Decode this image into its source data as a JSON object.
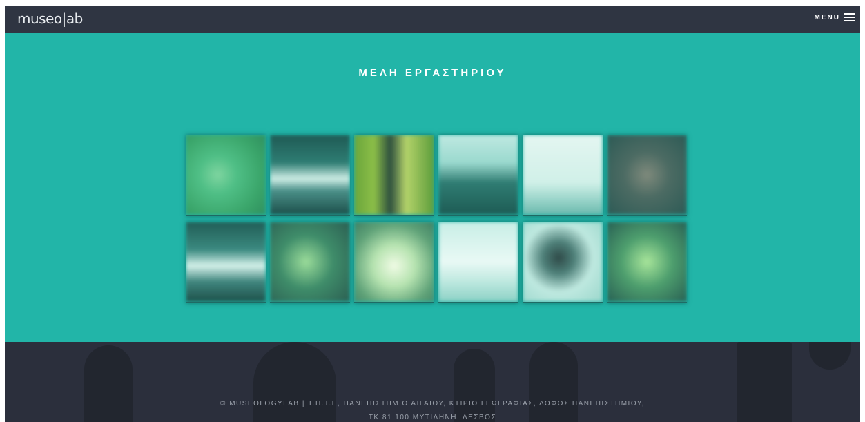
{
  "header": {
    "logo": "museo|ab",
    "menu_label": "MENU"
  },
  "main": {
    "title": "ΜΕΛΗ ΕΡΓΑΣΤΗΡΙΟΥ",
    "members": [
      {
        "icon": "member-photo"
      },
      {
        "icon": "member-photo"
      },
      {
        "icon": "member-photo"
      },
      {
        "icon": "member-photo"
      },
      {
        "icon": "member-photo"
      },
      {
        "icon": "member-photo"
      },
      {
        "icon": "member-photo"
      },
      {
        "icon": "member-photo"
      },
      {
        "icon": "member-photo"
      },
      {
        "icon": "member-photo"
      },
      {
        "icon": "member-photo"
      },
      {
        "icon": "member-photo"
      }
    ]
  },
  "footer": {
    "line1": "© MUSEOLOGYLAB  |  Τ.Π.Τ.Ε, ΠΑΝΕΠΙΣΤΗΜΙΟ ΑΙΓΑΙΟΥ, ΚΤΙΡΙΟ ΓΕΩΓΡΑΦΙΑΣ, ΛΟΦΟΣ ΠΑΝΕΠΙΣΤΗΜΙΟΥ,",
    "line2": "ΤΚ 81 100 ΜΥΤΙΛΗΝΗ, ΛΕΣΒΟΣ"
  },
  "colors": {
    "topbar": "#2f3542",
    "accent": "#22b5a8",
    "footer": "#2b2f3c"
  }
}
